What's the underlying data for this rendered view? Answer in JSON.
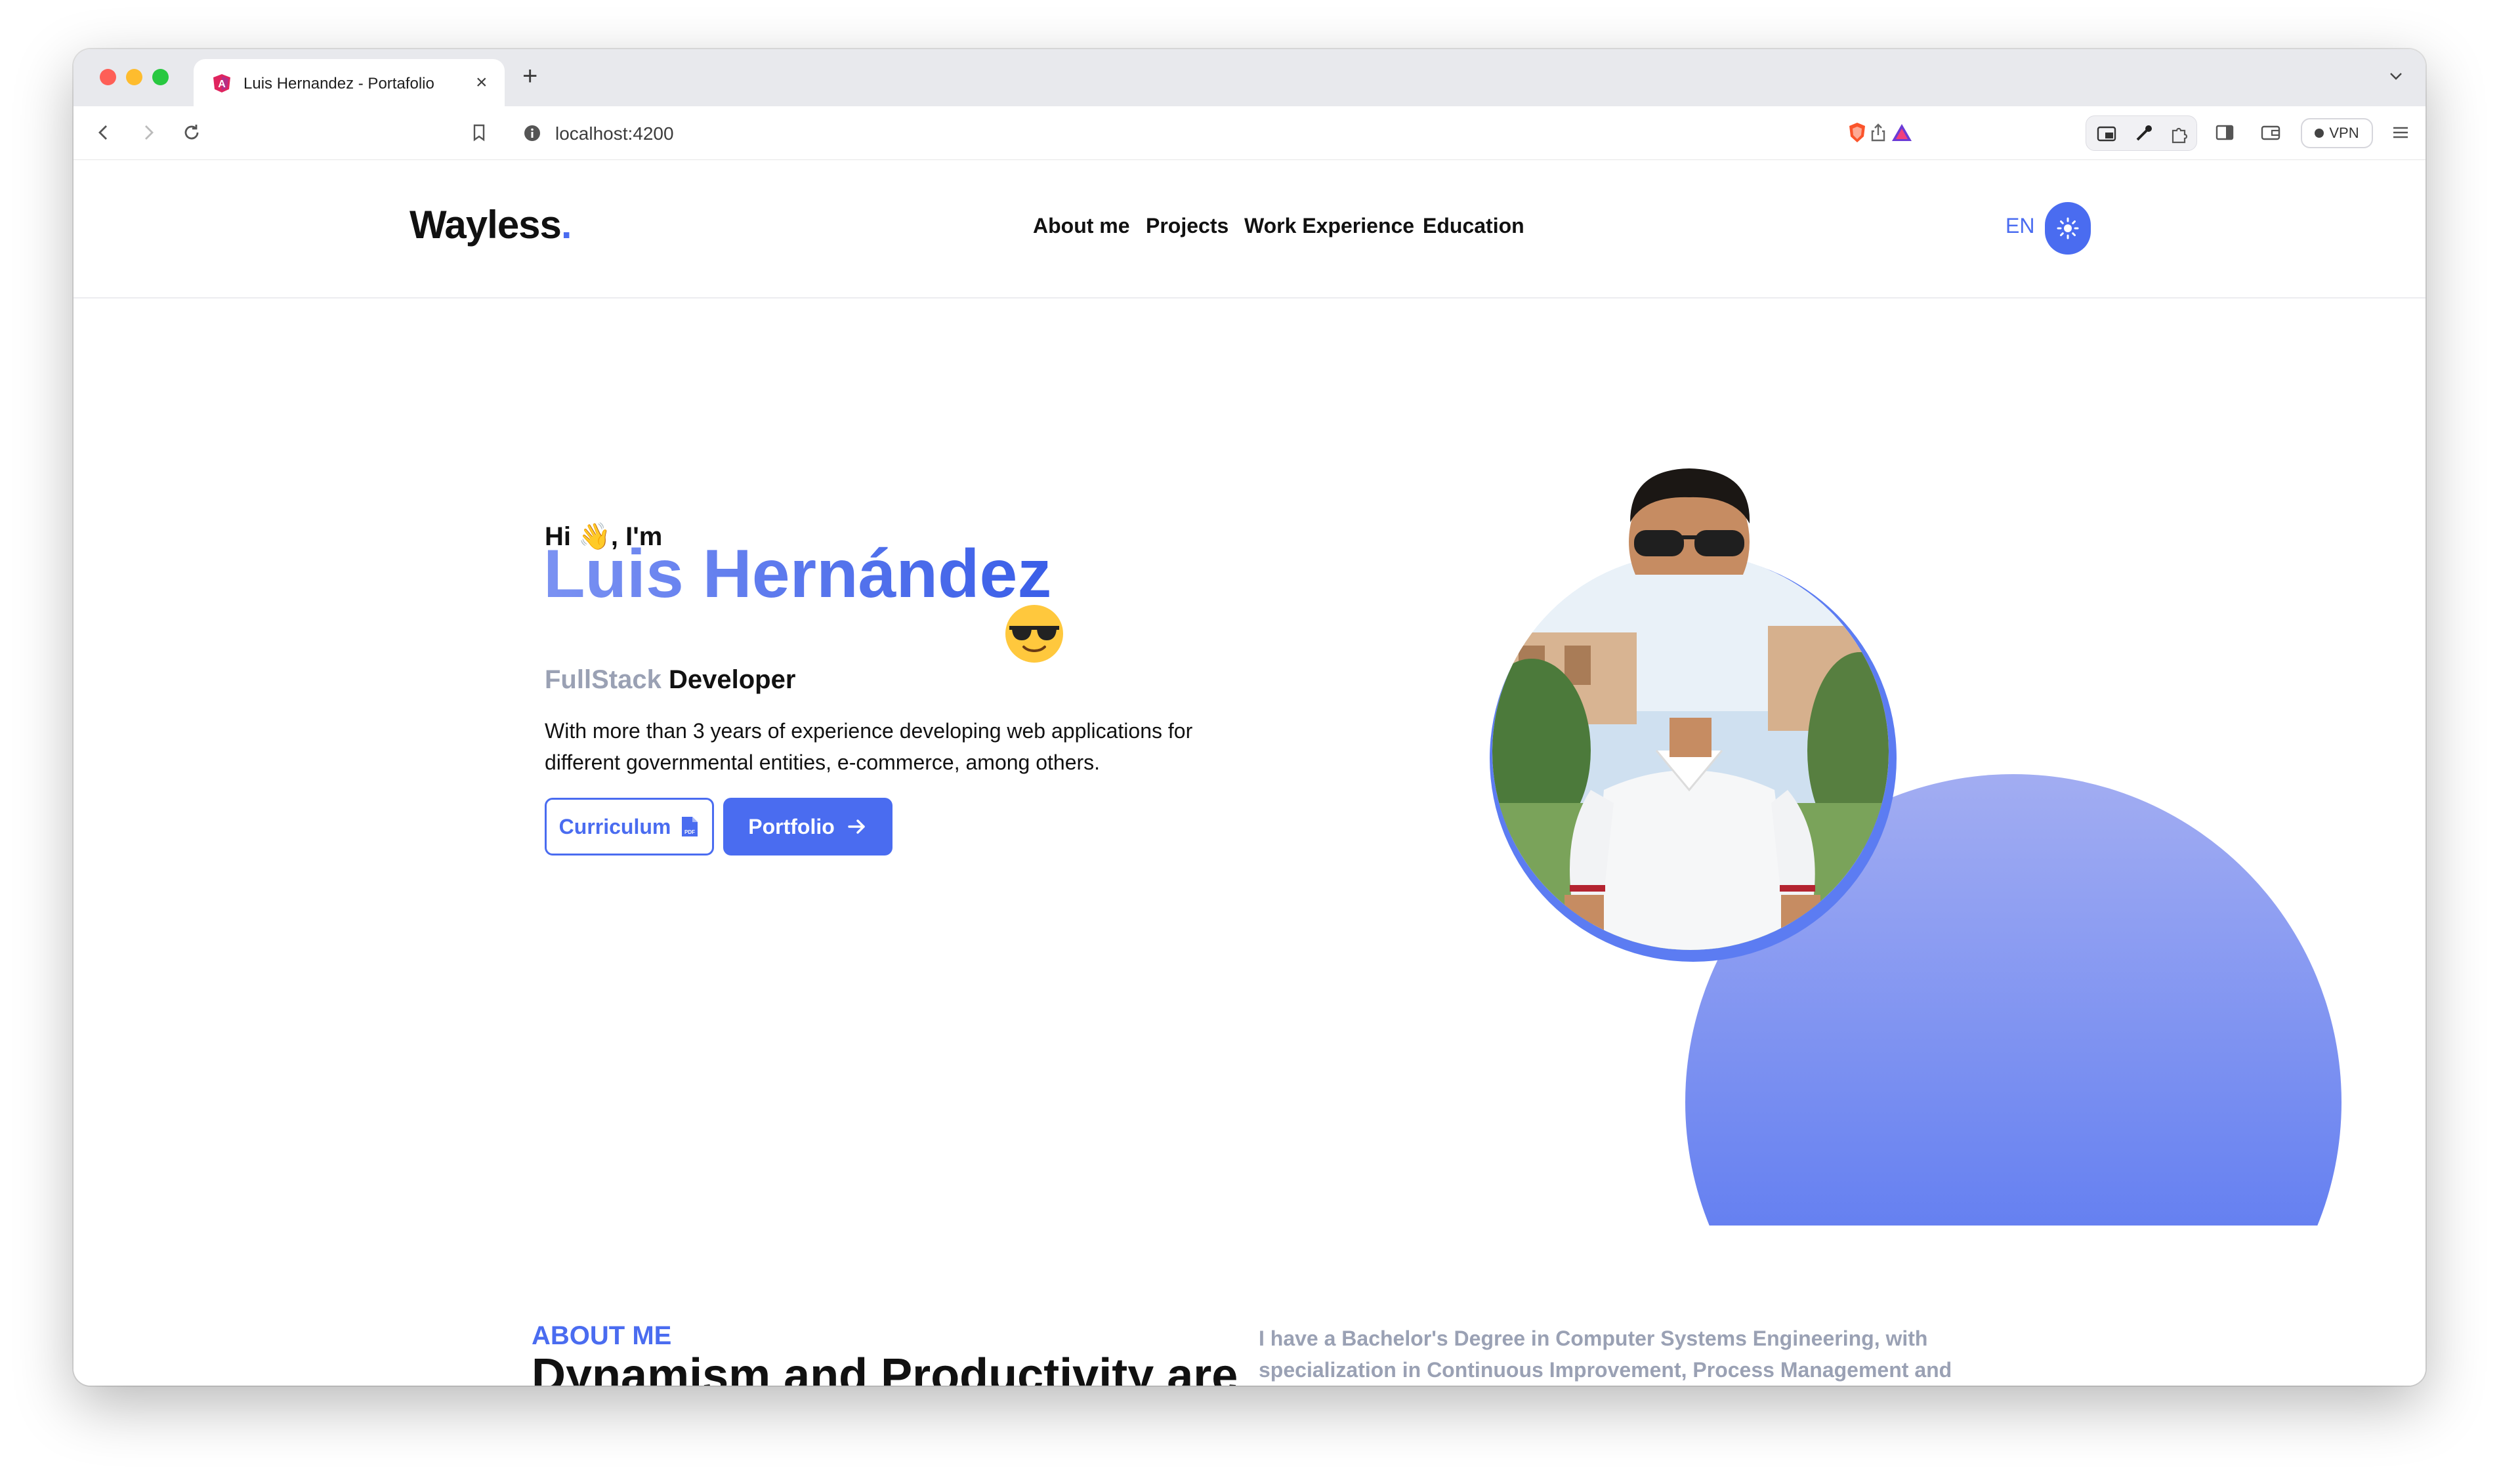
{
  "browser": {
    "tab_title": "Luis Hernandez - Portafolio",
    "url": "localhost:4200",
    "vpn_label": "VPN"
  },
  "header": {
    "logo_text": "Wayless",
    "logo_dot": ".",
    "nav": [
      "About me",
      "Projects",
      "Work Experience",
      "Education"
    ],
    "lang": "EN"
  },
  "hero": {
    "greeting": "Hi 👋, I'm",
    "name": "Luis Hernández",
    "role_prefix": "FullStack",
    "role_suffix": "Developer",
    "description": "With more than 3 years of experience developing web applications for different governmental entities, e-commerce, among others.",
    "btn_cv": "Curriculum",
    "btn_portfolio": "Portfolio"
  },
  "about": {
    "label": "ABOUT ME",
    "title": "Dynamism and Productivity are what represent me",
    "text": "I have a Bachelor's Degree in Computer Systems Engineering, with specialization in Continuous Improvement, Process Management and Quality. Currently, I am pursuing a Master's Degree in Systems Engineering with a specialization in Information Systems Management."
  },
  "colors": {
    "accent": "#4a6cf0",
    "muted": "#9aa1b4",
    "text": "#111111"
  }
}
